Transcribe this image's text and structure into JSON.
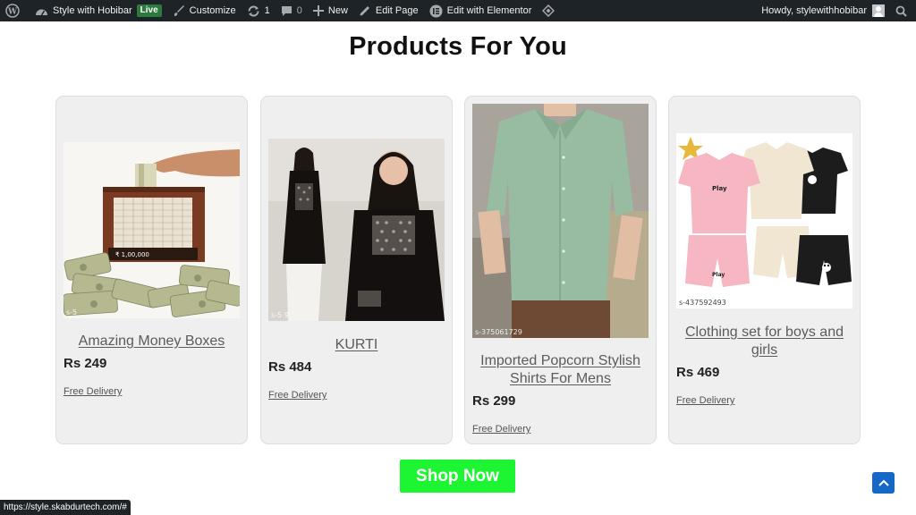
{
  "admin_bar": {
    "site_name": "Style with Hobibar",
    "live_badge": "Live",
    "customize": "Customize",
    "updates_count": "1",
    "comments_count": "0",
    "new": "New",
    "edit_page": "Edit Page",
    "edit_elementor": "Edit with Elementor",
    "howdy": "Howdy, stylewithhobibar"
  },
  "section": {
    "title": "Products For You"
  },
  "products": [
    {
      "name": "Amazing Money Boxes",
      "price": "Rs 249",
      "delivery": "Free Delivery",
      "sku": "s-5"
    },
    {
      "name": "KURTI",
      "price": "Rs 484",
      "delivery": "Free Delivery",
      "sku": "s-5 9"
    },
    {
      "name": "Imported Popcorn Stylish Shirts For Mens",
      "price": "Rs 299",
      "delivery": "Free Delivery",
      "sku": "s-375061729"
    },
    {
      "name": "Clothing set for boys and girls",
      "price": "Rs 469",
      "delivery": "Free Delivery",
      "sku": "s-437592493"
    }
  ],
  "money_box_label": "₹ 1,00,000",
  "tshirt_text": "Play",
  "cta": {
    "label": "Shop Now"
  },
  "status_url": "https://style.skabdurtech.com/#"
}
